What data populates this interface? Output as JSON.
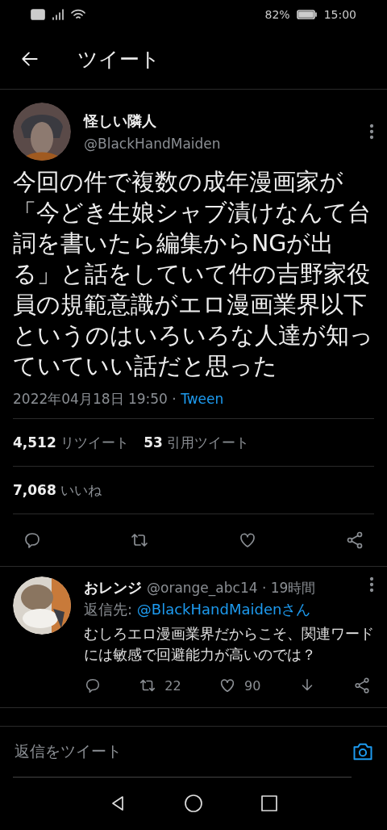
{
  "status_bar": {
    "battery": "82%",
    "time": "15:00"
  },
  "header": {
    "title": "ツイート"
  },
  "tweet": {
    "name": "怪しい隣人",
    "handle": "@BlackHandMaiden",
    "text": "今回の件で複数の成年漫画家が「今どき生娘シャブ漬けなんて台詞を書いたら編集からNGが出る」と話をしていて件の吉野家役員の規範意識がエロ漫画業界以下というのはいろいろな人達が知っていていい話だと思った",
    "date": "2022年04月18日 19:50 · ",
    "source": "Tween",
    "retweets": {
      "count": "4,512",
      "label": "リツイート"
    },
    "quotes": {
      "count": "53",
      "label": "引用ツイート"
    },
    "likes": {
      "count": "7,068",
      "label": "いいね"
    }
  },
  "reply": {
    "name": "おレンジ",
    "meta": "@orange_abc14 · 19時間",
    "reply_to_label": "返信先: ",
    "reply_to": "@BlackHandMaidenさん",
    "text": "むしろエロ漫画業界だからこそ、関連ワードには敏感で回避能力が高いのでは？",
    "retweets": "22",
    "likes": "90"
  },
  "compose": {
    "placeholder": "返信をツイート"
  }
}
